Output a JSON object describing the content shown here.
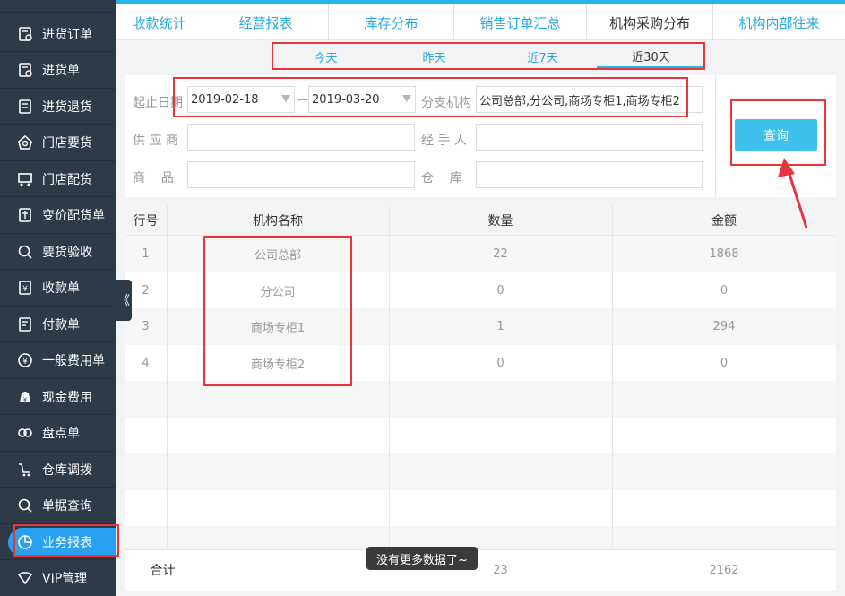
{
  "sidebar": {
    "items": [
      {
        "label": "进货订单",
        "icon": "purchase-order-icon"
      },
      {
        "label": "进货单",
        "icon": "purchase-receipt-icon"
      },
      {
        "label": "进货退货",
        "icon": "purchase-return-icon"
      },
      {
        "label": "门店要货",
        "icon": "store-request-icon"
      },
      {
        "label": "门店配货",
        "icon": "store-distribution-icon"
      },
      {
        "label": "变价配货单",
        "icon": "price-change-icon"
      },
      {
        "label": "要货验收",
        "icon": "inspection-icon"
      },
      {
        "label": "收款单",
        "icon": "receipt-icon"
      },
      {
        "label": "付款单",
        "icon": "payment-icon"
      },
      {
        "label": "一般费用单",
        "icon": "yen-icon"
      },
      {
        "label": "现金费用",
        "icon": "cash-bag-icon"
      },
      {
        "label": "盘点单",
        "icon": "stocktake-icon"
      },
      {
        "label": "仓库调拨",
        "icon": "cart-transfer-icon"
      },
      {
        "label": "单据查询",
        "icon": "search-icon"
      },
      {
        "label": "业务报表",
        "icon": "pie-chart-icon",
        "active": true
      },
      {
        "label": "VIP管理",
        "icon": "vip-icon"
      }
    ],
    "collapse_glyph": "《"
  },
  "tabs": [
    {
      "label": "收款统计"
    },
    {
      "label": "经营报表"
    },
    {
      "label": "库存分布"
    },
    {
      "label": "销售订单汇总"
    },
    {
      "label": "机构采购分布",
      "active": true
    },
    {
      "label": "机构内部往来"
    }
  ],
  "quick_dates": [
    {
      "label": "今天"
    },
    {
      "label": "昨天"
    },
    {
      "label": "近7天"
    },
    {
      "label": "近30天",
      "active": true
    }
  ],
  "filters": {
    "date_label": "起止日期",
    "date_start": "2019-02-18",
    "date_separator": "—",
    "date_end": "2019-03-20",
    "branch_label": "分支机构",
    "branch_value": "公司总部,分公司,商场专柜1,商场专柜2",
    "supplier_label": "供 应 商",
    "supplier_value": "",
    "handler_label": "经 手 人",
    "handler_value": "",
    "product_label": "商    品",
    "product_value": "",
    "warehouse_label": "仓    库",
    "warehouse_value": "",
    "query_label": "查询"
  },
  "table": {
    "headers": [
      "行号",
      "机构名称",
      "数量",
      "金额"
    ],
    "rows": [
      {
        "no": "1",
        "name": "公司总部",
        "qty": "22",
        "amount": "1868"
      },
      {
        "no": "2",
        "name": "分公司",
        "qty": "0",
        "amount": "0"
      },
      {
        "no": "3",
        "name": "商场专柜1",
        "qty": "1",
        "amount": "294"
      },
      {
        "no": "4",
        "name": "商场专柜2",
        "qty": "0",
        "amount": "0"
      }
    ],
    "total": {
      "label": "合计",
      "qty": "23",
      "amount": "2162"
    }
  },
  "toast": "没有更多数据了~",
  "colors": {
    "sidebar_bg": "#2d3a48",
    "accent": "#29b6e6",
    "active_pill": "#2aa0f0",
    "query_button": "#3dc0ea",
    "annotation_red": "#e8353b"
  }
}
